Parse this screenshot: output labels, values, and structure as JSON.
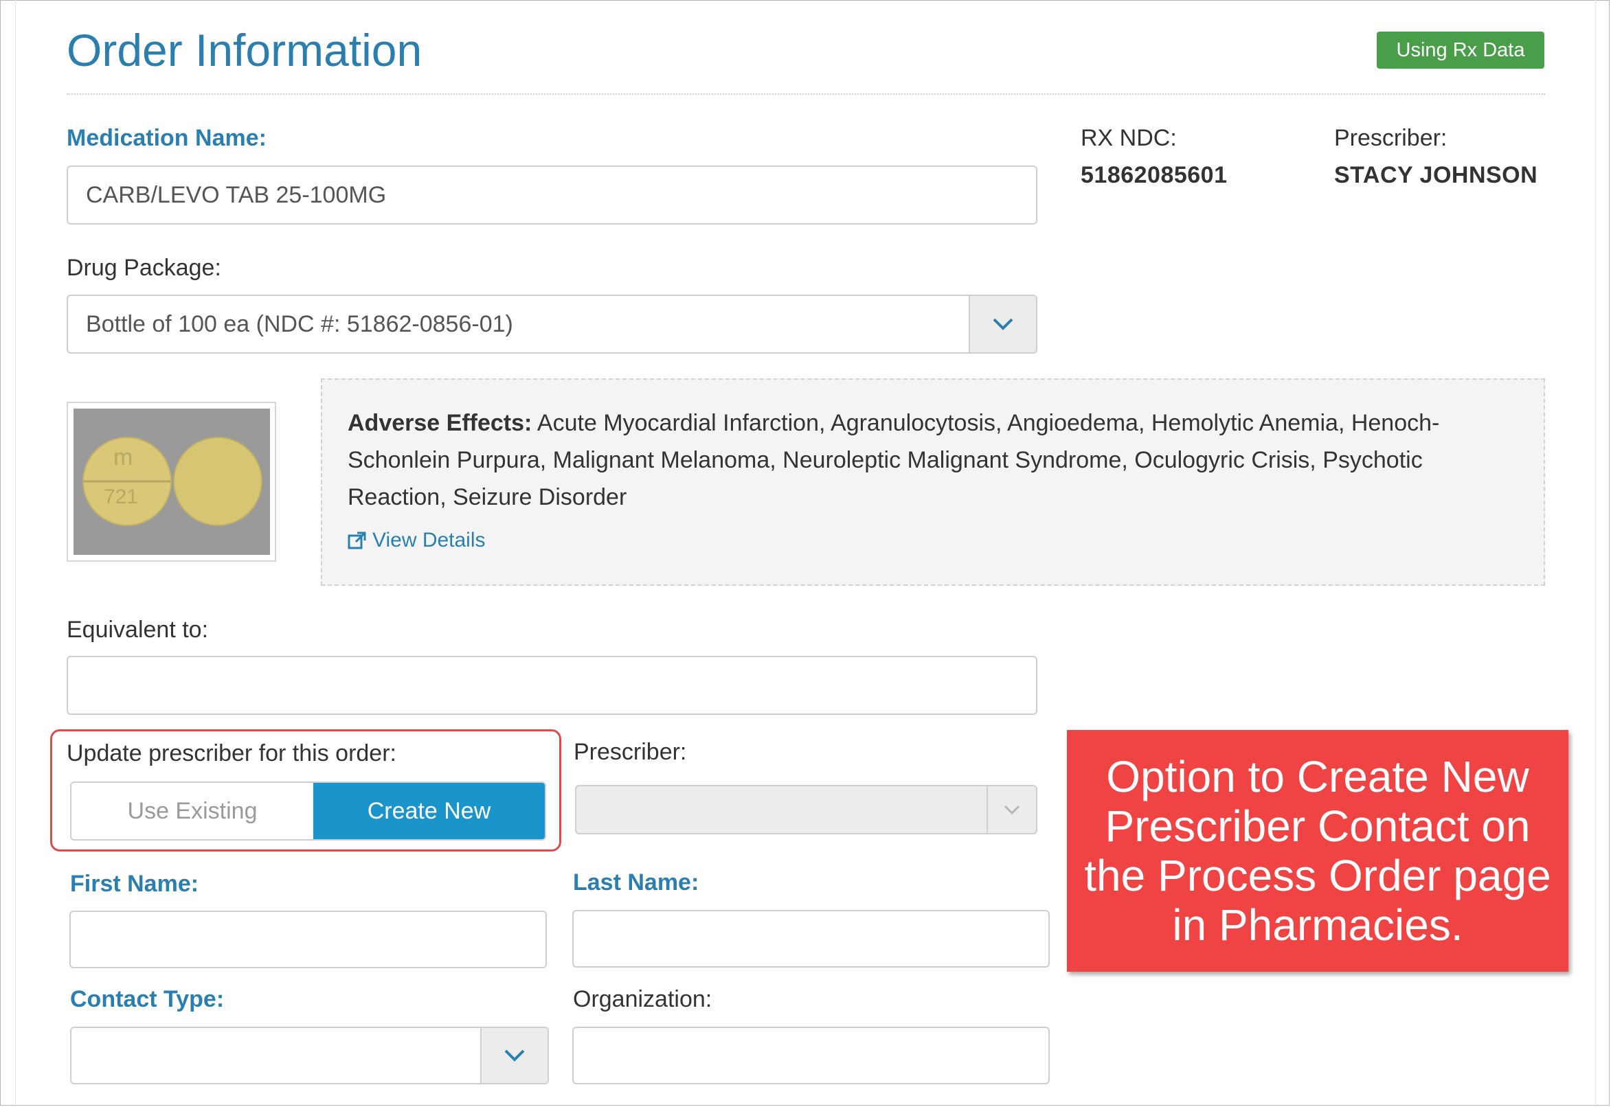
{
  "header": {
    "title": "Order Information",
    "badge": "Using Rx Data"
  },
  "medication": {
    "label": "Medication Name:",
    "value": "CARB/LEVO TAB 25-100MG"
  },
  "rx": {
    "ndc_label": "RX NDC:",
    "ndc_value": "51862085601",
    "prescriber_label": "Prescriber:",
    "prescriber_value": "STACY JOHNSON"
  },
  "drug_package": {
    "label": "Drug Package:",
    "value": "Bottle of 100 ea (NDC #: 51862-0856-01)"
  },
  "pill_image": {
    "imprint_top": "m",
    "imprint_bottom": "721"
  },
  "adverse": {
    "label": "Adverse Effects:",
    "text": "Acute Myocardial Infarction, Agranulocytosis, Angioedema, Hemolytic Anemia, Henoch-Schonlein Purpura, Malignant Melanoma, Neuroleptic Malignant Syndrome, Oculogyric Crisis, Psychotic Reaction, Seizure Disorder",
    "link": "View Details"
  },
  "equivalent": {
    "label": "Equivalent to:",
    "value": ""
  },
  "update_prescriber": {
    "label": "Update prescriber for this order:",
    "use_existing": "Use Existing",
    "create_new": "Create New"
  },
  "prescriber_select": {
    "label": "Prescriber:",
    "value": ""
  },
  "first_name": {
    "label": "First Name:",
    "value": ""
  },
  "last_name": {
    "label": "Last Name:",
    "value": ""
  },
  "contact_type": {
    "label": "Contact Type:",
    "value": ""
  },
  "organization": {
    "label": "Organization:",
    "value": ""
  },
  "callout": {
    "text": "Option to Create New Prescriber Contact on the Process Order page in Pharmacies."
  },
  "colors": {
    "accent_blue": "#2a7fb0",
    "button_blue": "#1a95cc",
    "badge_green": "#4a9e4a",
    "callout_red": "#f04444"
  }
}
